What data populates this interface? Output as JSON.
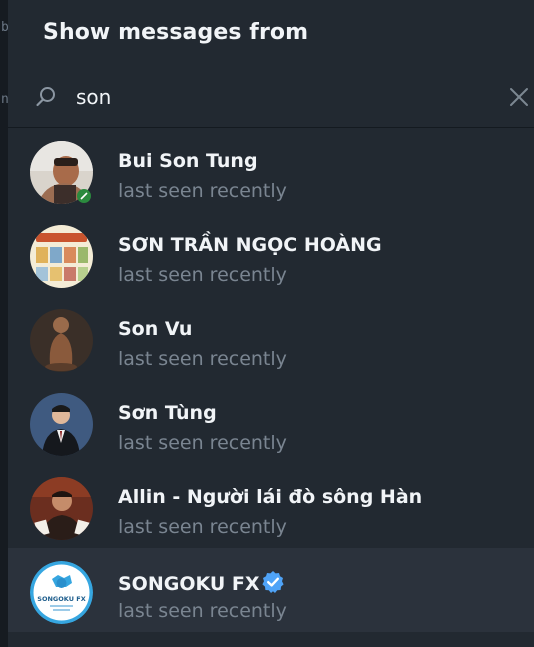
{
  "header": {
    "title": "Show messages from"
  },
  "search": {
    "value": "son",
    "placeholder": ""
  },
  "left_strip": {
    "glyphs": [
      "b",
      "n"
    ]
  },
  "contacts": [
    {
      "name": "Bui Son Tung",
      "status": "last seen recently",
      "verified": false
    },
    {
      "name": "SƠN TRẦN NGỌC HOÀNG",
      "status": "last seen recently",
      "verified": false
    },
    {
      "name": "Son Vu",
      "status": "last seen recently",
      "verified": false
    },
    {
      "name": "Sơn Tùng",
      "status": "last seen recently",
      "verified": false
    },
    {
      "name": "Allin - Người lái đò sông Hàn",
      "status": "last seen recently",
      "verified": false
    },
    {
      "name": "SONGOKU FX",
      "status": "last seen recently",
      "verified": true,
      "selected": true
    }
  ],
  "avatars": {
    "songoku_text": "SONGOKU FX"
  },
  "colors": {
    "panel_bg": "#222931",
    "selected_row_bg": "#2b323c",
    "name_text": "#f1f4f7",
    "status_text": "#7a8591",
    "verified_badge": "#4fa3f7"
  }
}
